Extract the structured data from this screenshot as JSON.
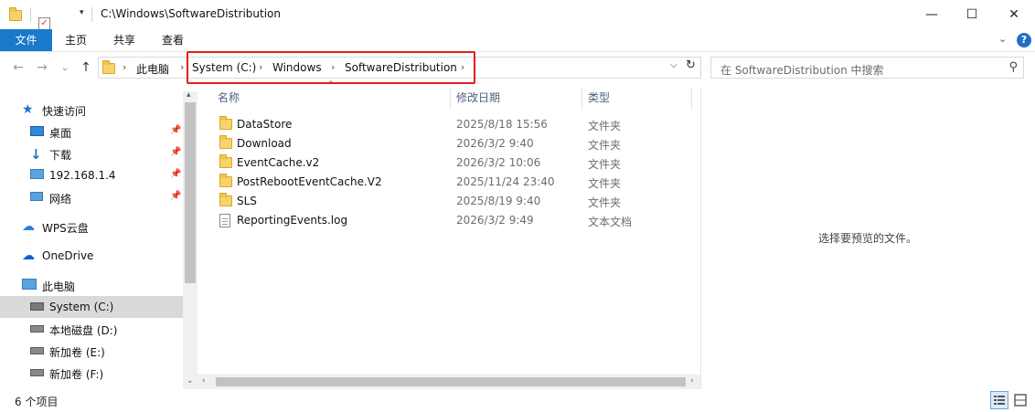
{
  "window": {
    "title": "C:\\Windows\\SoftwareDistribution",
    "controls": {
      "minimize": "—",
      "maximize": "☐",
      "close": "✕"
    }
  },
  "ribbon": {
    "tabs": [
      "文件",
      "主页",
      "共享",
      "查看"
    ],
    "expand_icon": "chevron-down-icon",
    "help_label": "?"
  },
  "navigation": {
    "back": "←",
    "forward": "→",
    "recent": "⌄",
    "up": "↑"
  },
  "address": {
    "root": "此电脑",
    "crumbs": [
      "System (C:)",
      "Windows",
      "SoftwareDistribution"
    ],
    "highlight_color": "#e51d1d"
  },
  "search": {
    "placeholder": "在 SoftwareDistribution 中搜索"
  },
  "sidebar": {
    "items": [
      {
        "label": "快速访问",
        "icon": "star-icon",
        "level": 0
      },
      {
        "label": "桌面",
        "icon": "desktop-icon",
        "level": 1,
        "pinned": true
      },
      {
        "label": "下载",
        "icon": "download-icon",
        "level": 1,
        "pinned": true
      },
      {
        "label": "192.168.1.4",
        "icon": "monitor-icon",
        "level": 1,
        "pinned": true
      },
      {
        "label": "网络",
        "icon": "network-icon",
        "level": 1,
        "pinned": true
      },
      {
        "label": "WPS云盘",
        "icon": "cloud-icon",
        "level": 0
      },
      {
        "label": "OneDrive",
        "icon": "onedrive-icon",
        "level": 0
      },
      {
        "label": "此电脑",
        "icon": "computer-icon",
        "level": 0
      },
      {
        "label": "System (C:)",
        "icon": "system-drive-icon",
        "level": 1,
        "selected": true
      },
      {
        "label": "本地磁盘 (D:)",
        "icon": "drive-icon",
        "level": 1
      },
      {
        "label": "新加卷 (E:)",
        "icon": "drive-icon",
        "level": 1
      },
      {
        "label": "新加卷 (F:)",
        "icon": "drive-icon",
        "level": 1
      }
    ]
  },
  "columns": {
    "name": "名称",
    "modified": "修改日期",
    "type": "类型"
  },
  "files": [
    {
      "name": "DataStore",
      "modified": "2025/8/18 15:56",
      "type": "文件夹",
      "icon": "folder-icon"
    },
    {
      "name": "Download",
      "modified": "2026/3/2 9:40",
      "type": "文件夹",
      "icon": "folder-icon"
    },
    {
      "name": "EventCache.v2",
      "modified": "2026/3/2 10:06",
      "type": "文件夹",
      "icon": "folder-icon"
    },
    {
      "name": "PostRebootEventCache.V2",
      "modified": "2025/11/24 23:40",
      "type": "文件夹",
      "icon": "folder-icon"
    },
    {
      "name": "SLS",
      "modified": "2025/8/19 9:40",
      "type": "文件夹",
      "icon": "folder-icon"
    },
    {
      "name": "ReportingEvents.log",
      "modified": "2026/3/2 9:49",
      "type": "文本文档",
      "icon": "text-file-icon"
    }
  ],
  "preview": {
    "message": "选择要预览的文件。"
  },
  "status": {
    "item_count": "6 个项目"
  },
  "colors": {
    "file_tab": "#1979ca",
    "folder": "#f7d36b",
    "selected_row": "#d9d9d9"
  }
}
